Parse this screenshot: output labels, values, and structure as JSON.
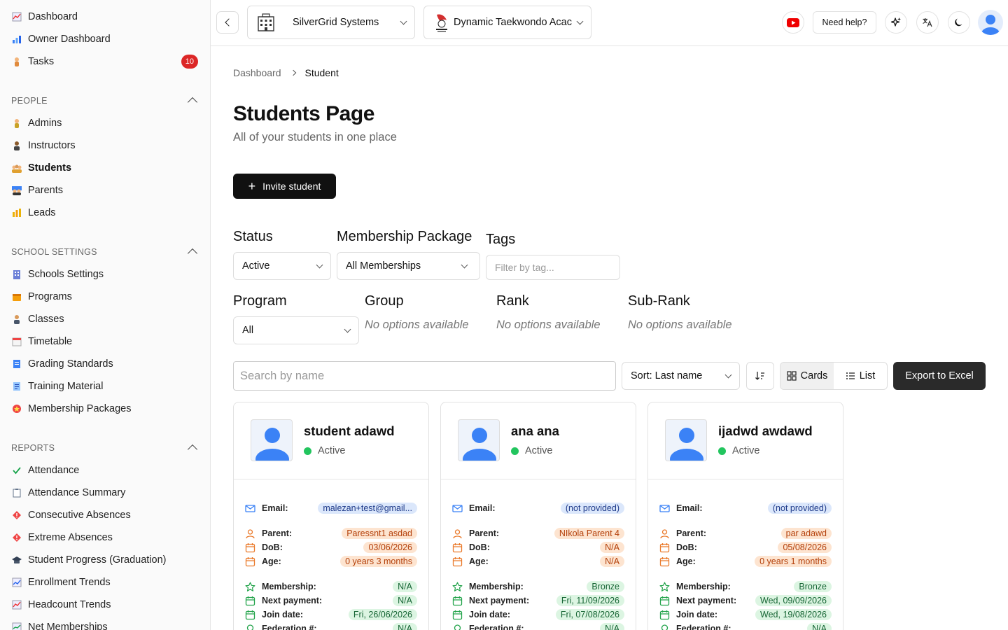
{
  "sidebar": {
    "top_items": [
      {
        "label": "Dashboard",
        "icon": "chart-icon"
      },
      {
        "label": "Owner Dashboard",
        "icon": "bar-chart-icon"
      },
      {
        "label": "Tasks",
        "icon": "person-icon",
        "badge": "10"
      }
    ],
    "people": {
      "title": "PEOPLE",
      "items": [
        {
          "label": "Admins"
        },
        {
          "label": "Instructors"
        },
        {
          "label": "Students",
          "active": true
        },
        {
          "label": "Parents"
        },
        {
          "label": "Leads"
        }
      ]
    },
    "school_settings": {
      "title": "SCHOOL SETTINGS",
      "items": [
        {
          "label": "Schools Settings"
        },
        {
          "label": "Programs"
        },
        {
          "label": "Classes"
        },
        {
          "label": "Timetable"
        },
        {
          "label": "Grading Standards"
        },
        {
          "label": "Training Material"
        },
        {
          "label": "Membership Packages"
        }
      ]
    },
    "reports": {
      "title": "REPORTS",
      "items": [
        {
          "label": "Attendance"
        },
        {
          "label": "Attendance Summary"
        },
        {
          "label": "Consecutive Absences"
        },
        {
          "label": "Extreme Absences"
        },
        {
          "label": "Student Progress (Graduation)"
        },
        {
          "label": "Enrollment Trends"
        },
        {
          "label": "Headcount Trends"
        },
        {
          "label": "Net Memberships"
        }
      ]
    }
  },
  "topbar": {
    "organization": "SilverGrid Systems",
    "school": "Dynamic Taekwondo Acac",
    "help_label": "Need help?"
  },
  "breadcrumb": {
    "root": "Dashboard",
    "current": "Student"
  },
  "page": {
    "title": "Students Page",
    "subtitle": "All of your students in one place",
    "invite_label": "Invite student"
  },
  "filters": {
    "status_label": "Status",
    "status_value": "Active",
    "membership_label": "Membership Package",
    "membership_value": "All Memberships",
    "tags_label": "Tags",
    "tags_placeholder": "Filter by tag...",
    "program_label": "Program",
    "program_value": "All",
    "group_label": "Group",
    "group_value": "No options available",
    "rank_label": "Rank",
    "rank_value": "No options available",
    "subrank_label": "Sub-Rank",
    "subrank_value": "No options available"
  },
  "toolbar": {
    "search_placeholder": "Search by name",
    "sort_value": "Sort: Last name",
    "cards_label": "Cards",
    "list_label": "List",
    "export_label": "Export to Excel"
  },
  "labels": {
    "email": "Email:",
    "parent": "Parent:",
    "dob": "DoB:",
    "age": "Age:",
    "membership": "Membership:",
    "next_payment": "Next payment:",
    "join_date": "Join date:",
    "federation": "Federation #:"
  },
  "students": [
    {
      "name": "student adawd",
      "status": "Active",
      "email": "malezan+test@gmail...",
      "parent": "Paressnt1 asdad",
      "dob": "03/06/2026",
      "age": "0 years 3 months",
      "membership": "N/A",
      "next_payment": "N/A",
      "join_date": "Fri, 26/06/2026",
      "federation": "N/A"
    },
    {
      "name": "ana ana",
      "status": "Active",
      "email": "(not provided)",
      "parent": "NIkola Parent 4",
      "dob": "N/A",
      "age": "N/A",
      "membership": "Bronze",
      "next_payment": "Fri, 11/09/2026",
      "join_date": "Fri, 07/08/2026",
      "federation": "N/A"
    },
    {
      "name": "ijadwd awdawd",
      "status": "Active",
      "email": "(not provided)",
      "parent": "par adawd",
      "dob": "05/08/2026",
      "age": "0 years 1 months",
      "membership": "Bronze",
      "next_payment": "Wed, 09/09/2026",
      "join_date": "Wed, 19/08/2026",
      "federation": "N/A"
    }
  ]
}
